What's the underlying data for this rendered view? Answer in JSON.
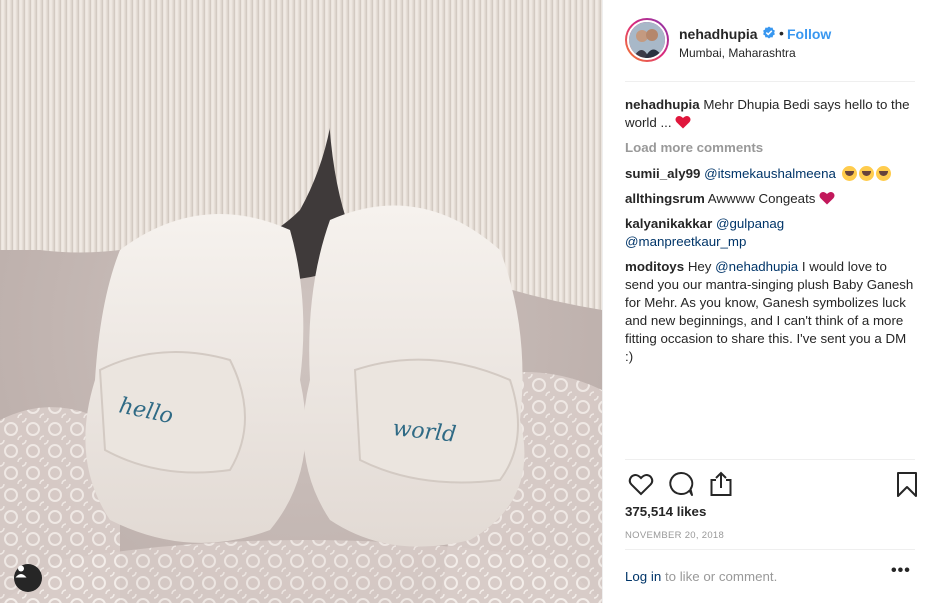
{
  "header": {
    "username": "nehadhupia",
    "separator": "•",
    "follow_label": "Follow",
    "location": "Mumbai, Maharashtra"
  },
  "caption": {
    "author": "nehadhupia",
    "text": "Mehr Dhupia Bedi says hello to the world ..."
  },
  "load_more_label": "Load more comments",
  "comments": [
    {
      "author": "sumii_aly99",
      "mention": "@itsmekaushalmeena",
      "text": ""
    },
    {
      "author": "allthingsrum",
      "mention": "",
      "text": "Awwww Congeats"
    },
    {
      "author": "kalyanikakkar",
      "mention": "@gulpanag",
      "mention2": "@manpreetkaur_mp",
      "text": ""
    },
    {
      "author": "moditoys",
      "text_before": "Hey",
      "mention": "@nehadhupia",
      "text": "I would love to send you our mantra-singing plush Baby Ganesh for Mehr. As you know, Ganesh symbolizes luck and new beginnings, and I can't think of a more fitting occasion to share this. I've sent you a DM :)"
    }
  ],
  "stats": {
    "likes": "375,514 likes",
    "date": "NOVEMBER 20, 2018"
  },
  "footer": {
    "login_label": "Log in",
    "login_suffix": "to like or comment.",
    "more_label": "•••"
  },
  "photo": {
    "embroidery_left": "hello",
    "embroidery_right": "world"
  },
  "icons": {
    "verified": "verified-badge-icon",
    "like": "heart-outline-icon",
    "comment": "speech-bubble-icon",
    "share": "share-upload-icon",
    "save": "bookmark-icon",
    "tag": "user-tag-icon"
  },
  "colors": {
    "link_blue": "#3897f0",
    "mention_blue": "#003569",
    "muted": "#999999",
    "text": "#262626",
    "heart_red": "#e0173c"
  }
}
